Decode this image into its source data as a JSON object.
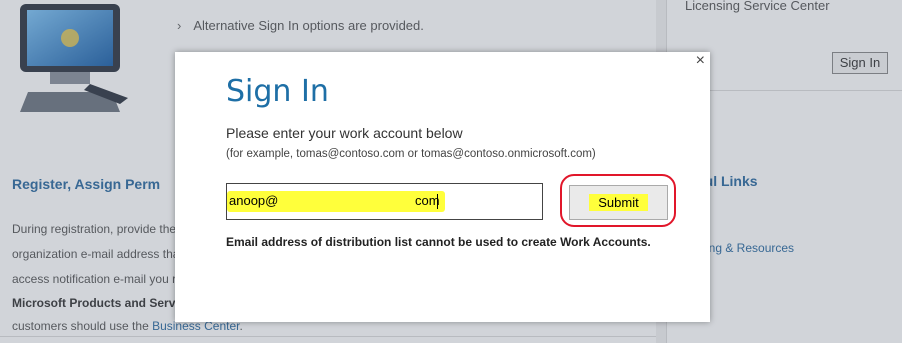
{
  "background": {
    "bullet_text": "Alternative Sign In options are provided.",
    "licensing_text": "Licensing Service Center",
    "sign_in_button": "Sign In",
    "left_heading": "Register, Assign Perm",
    "right_heading": "ful Links",
    "paragraph_lines": [
      "During registration, provide the",
      "organization e-mail address tha",
      "access notification e-mail you r"
    ],
    "bold_line": "Microsoft Products and Servi",
    "last_line_prefix": "customers should use the ",
    "last_line_link": "Business Center",
    "last_line_suffix": ".",
    "right_link": "sing & Resources"
  },
  "modal": {
    "title": "Sign In",
    "prompt": "Please enter your work account below",
    "example": "(for example, tomas@contoso.com or tomas@contoso.onmicrosoft.com)",
    "email_prefix": "anoop@",
    "email_suffix": "com",
    "submit_label": "Submit",
    "warning": "Email address of distribution list cannot be used to create Work Accounts.",
    "close_glyph": "×"
  },
  "colors": {
    "accent": "#1e6fa6",
    "highlight": "#ffff3b",
    "annotation": "#e1162a"
  }
}
